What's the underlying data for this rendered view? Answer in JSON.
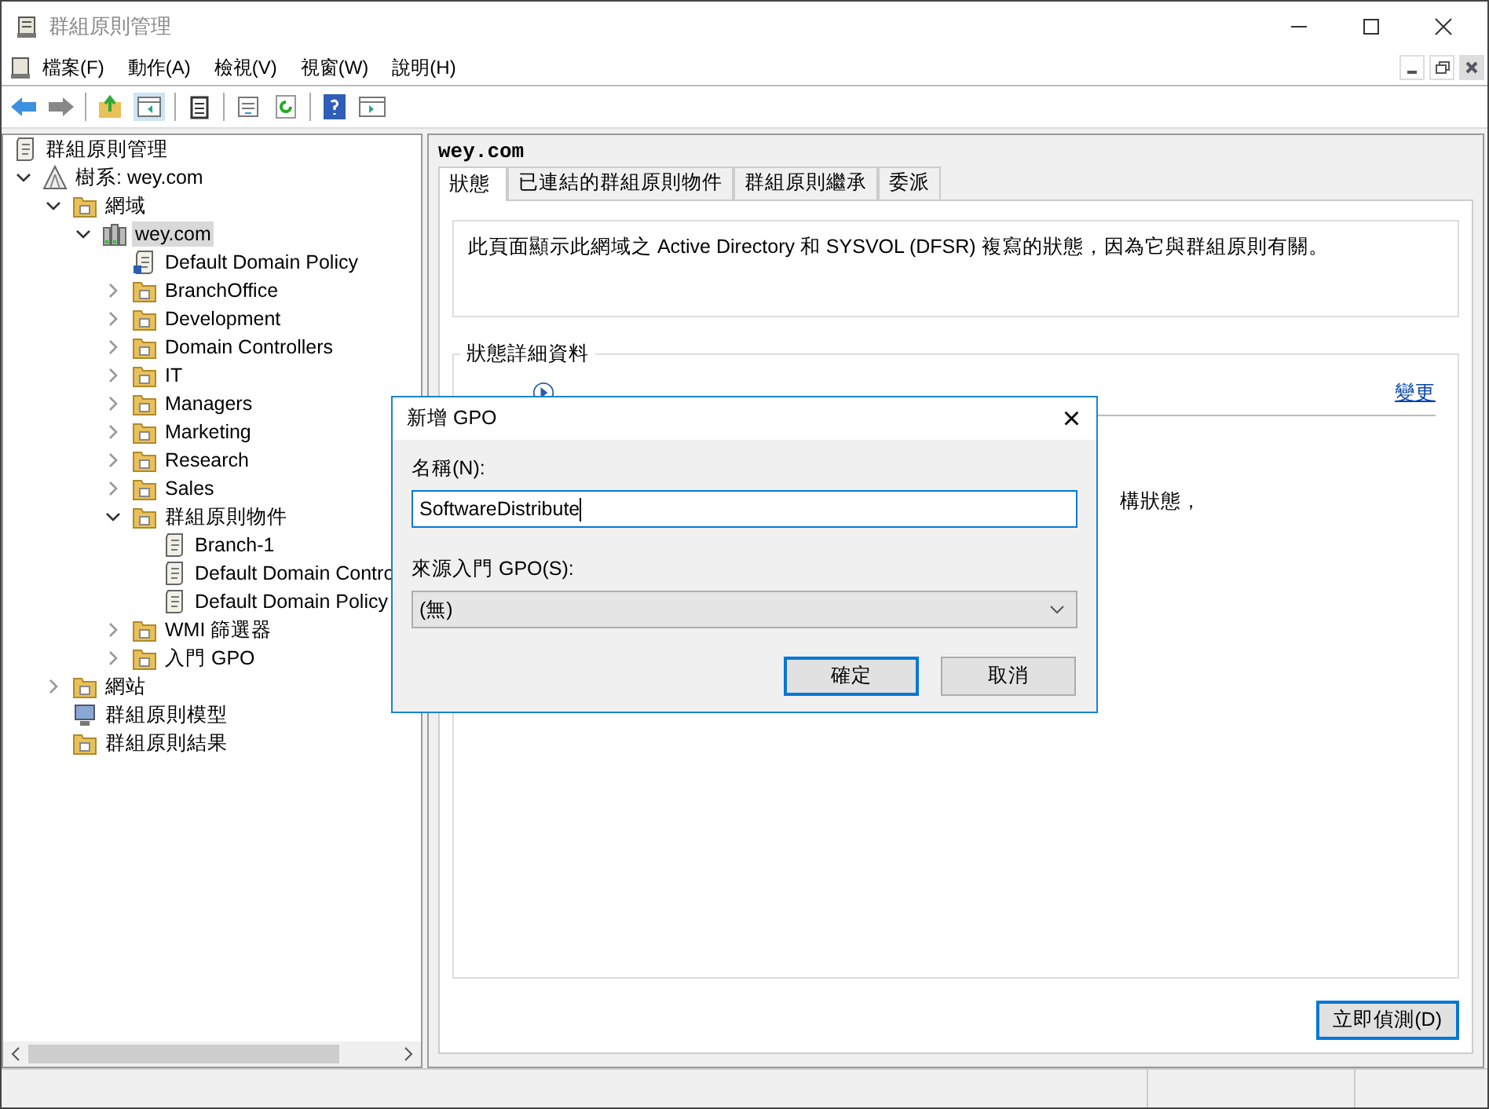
{
  "window": {
    "title": "群組原則管理"
  },
  "menu": [
    "檔案(F)",
    "動作(A)",
    "檢視(V)",
    "視窗(W)",
    "說明(H)"
  ],
  "tree": [
    {
      "label": "群組原則管理",
      "kind": "gpm",
      "selected": false,
      "children": [
        {
          "label": "樹系: wey.com",
          "kind": "forest",
          "expanded": true,
          "selected": false,
          "children": [
            {
              "label": "網域",
              "kind": "domains",
              "expanded": true,
              "selected": false,
              "children": [
                {
                  "label": "wey.com",
                  "kind": "domain",
                  "expanded": true,
                  "selected": true,
                  "children": [
                    {
                      "label": "Default Domain Policy",
                      "kind": "gpolink",
                      "selected": false
                    },
                    {
                      "label": "BranchOffice",
                      "kind": "ou",
                      "expanded": false,
                      "selected": false
                    },
                    {
                      "label": "Development",
                      "kind": "ou",
                      "expanded": false,
                      "selected": false
                    },
                    {
                      "label": "Domain Controllers",
                      "kind": "ou",
                      "expanded": false,
                      "selected": false
                    },
                    {
                      "label": "IT",
                      "kind": "ou",
                      "expanded": false,
                      "selected": false
                    },
                    {
                      "label": "Managers",
                      "kind": "ou",
                      "expanded": false,
                      "selected": false
                    },
                    {
                      "label": "Marketing",
                      "kind": "ou",
                      "expanded": false,
                      "selected": false
                    },
                    {
                      "label": "Research",
                      "kind": "ou",
                      "expanded": false,
                      "selected": false
                    },
                    {
                      "label": "Sales",
                      "kind": "ou",
                      "expanded": false,
                      "selected": false
                    },
                    {
                      "label": "群組原則物件",
                      "kind": "gpofolder",
                      "expanded": true,
                      "selected": false,
                      "children": [
                        {
                          "label": "Branch-1",
                          "kind": "gpo",
                          "selected": false
                        },
                        {
                          "label": "Default Domain Contro",
                          "kind": "gpo",
                          "selected": false
                        },
                        {
                          "label": "Default Domain Policy",
                          "kind": "gpo",
                          "selected": false
                        }
                      ]
                    },
                    {
                      "label": "WMI 篩選器",
                      "kind": "wmi",
                      "expanded": false,
                      "selected": false
                    },
                    {
                      "label": "入門 GPO",
                      "kind": "starter",
                      "expanded": false,
                      "selected": false
                    }
                  ]
                }
              ]
            },
            {
              "label": "網站",
              "kind": "sites",
              "expanded": false,
              "selected": false
            },
            {
              "label": "群組原則模型",
              "kind": "modeling",
              "selected": false
            },
            {
              "label": "群組原則結果",
              "kind": "results",
              "selected": false
            }
          ]
        }
      ]
    }
  ],
  "detail": {
    "heading": "wey.com",
    "tabs": [
      {
        "label": "狀態",
        "selected": true
      },
      {
        "label": "已連結的群組原則物件",
        "selected": false
      },
      {
        "label": "群組原則繼承",
        "selected": false
      },
      {
        "label": "委派",
        "selected": false
      }
    ],
    "description": "此頁面顯示此網域之 Active Directory 和 SYSVOL (DFSR) 複寫的狀態，因為它與群組原則有關。",
    "group_title": "狀態詳細資料",
    "change_link": "變更",
    "partial_text": "構狀態，",
    "detect_button": "立即偵測(D)"
  },
  "dialog": {
    "title": "新增 GPO",
    "close": "×",
    "name_label": "名稱(N):",
    "name_value": "SoftwareDistribute",
    "source_label": "來源入門 GPO(S):",
    "source_value": "(無)",
    "buttons": [
      {
        "label": "確定",
        "kind": "default"
      },
      {
        "label": "取消",
        "kind": "normal"
      }
    ]
  }
}
